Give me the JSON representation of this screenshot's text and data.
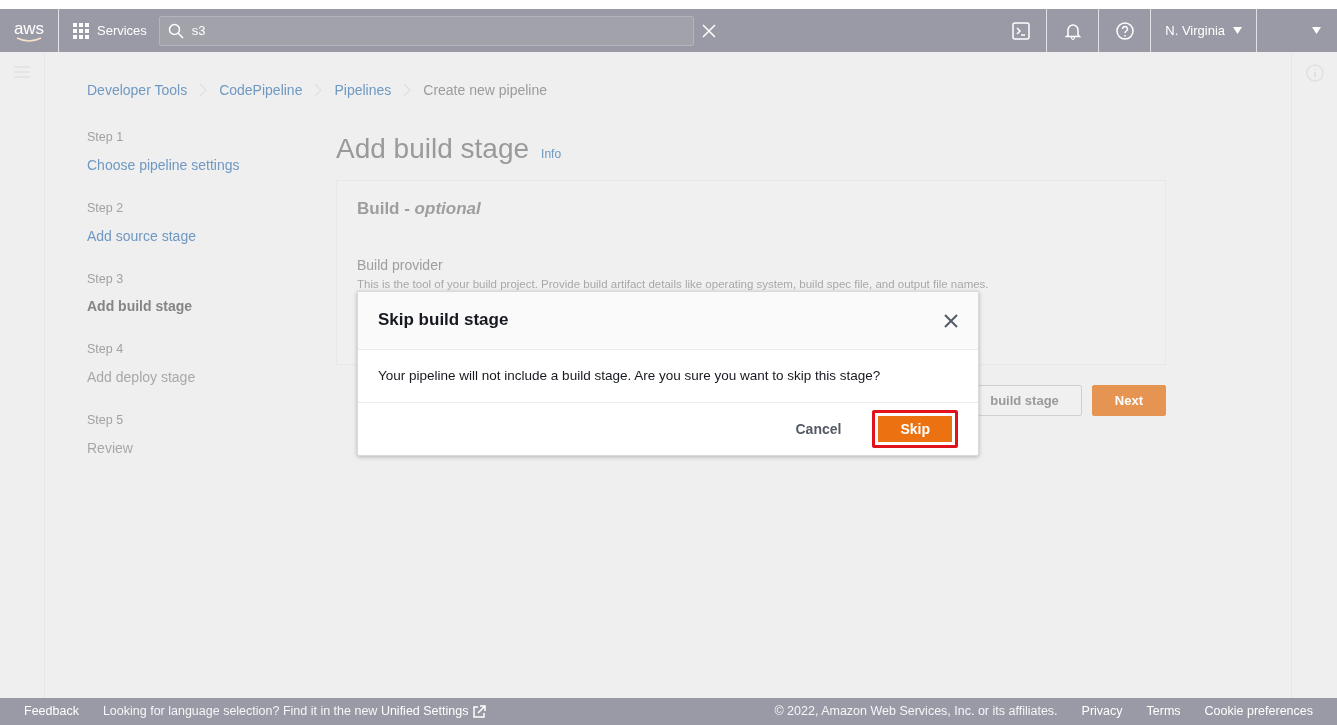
{
  "top_bar": {
    "logo": "aws",
    "services": "Services",
    "search": {
      "value": "s3"
    },
    "region": "N. Virginia"
  },
  "breadcrumbs": [
    {
      "label": "Developer Tools",
      "link": true
    },
    {
      "label": "CodePipeline",
      "link": true
    },
    {
      "label": "Pipelines",
      "link": true
    },
    {
      "label": "Create new pipeline",
      "link": false
    }
  ],
  "steps": [
    {
      "step": "Step 1",
      "title": "Choose pipeline settings",
      "kind": "done"
    },
    {
      "step": "Step 2",
      "title": "Add source stage",
      "kind": "done"
    },
    {
      "step": "Step 3",
      "title": "Add build stage",
      "kind": "current"
    },
    {
      "step": "Step 4",
      "title": "Add deploy stage",
      "kind": "todo"
    },
    {
      "step": "Step 5",
      "title": "Review",
      "kind": "todo"
    }
  ],
  "page": {
    "title": "Add build stage",
    "info": "Info",
    "card_title": "Build - *optional*",
    "field_label": "Build provider",
    "field_description": "This is the tool of your build project. Provide build artifact details like operating system, build spec file, and output file names.",
    "buttons": [
      {
        "label": "build stage",
        "kind": "secondary"
      },
      {
        "label": "Next",
        "kind": "primary"
      }
    ]
  },
  "dialog": {
    "title": "Skip build stage",
    "message": "Your pipeline will not include a build stage. Are you sure you want to skip this stage?",
    "buttons": [
      {
        "label": "Cancel",
        "kind": "link",
        "highlighted": false
      },
      {
        "label": "Skip",
        "kind": "primary",
        "highlighted": true
      }
    ]
  },
  "footer": {
    "feedback": "Feedback",
    "notice": "Looking for language selection? Find it in the new ",
    "notice_link": "Unified Settings",
    "copyright": "© 2022, Amazon Web Services, Inc. or its affiliates.",
    "links": [
      "Privacy",
      "Terms",
      "Cookie preferences"
    ]
  }
}
